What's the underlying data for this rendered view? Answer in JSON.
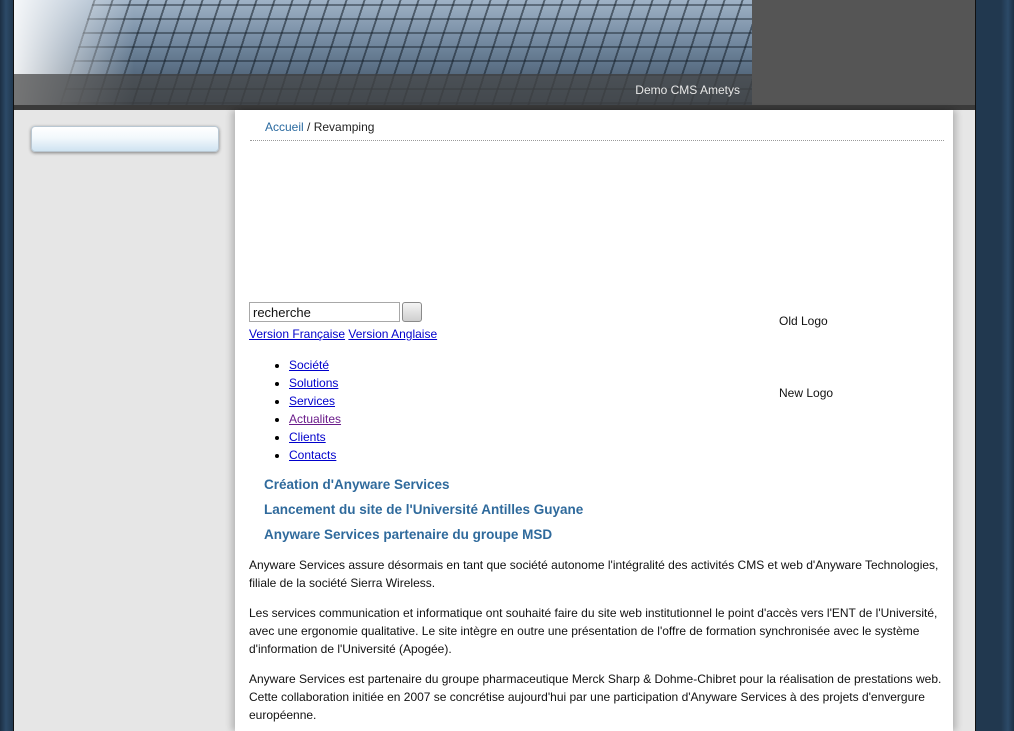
{
  "header": {
    "banner_caption": "Demo CMS Ametys"
  },
  "breadcrumb": {
    "home": "Accueil",
    "separator": "/",
    "current": "Revamping"
  },
  "search": {
    "value": "recherche"
  },
  "languages": {
    "french": "Version Française",
    "english": "Version Anglaise"
  },
  "logos": {
    "old": "Old Logo",
    "new": "New Logo"
  },
  "menu": {
    "items": [
      {
        "label": "Société"
      },
      {
        "label": "Solutions"
      },
      {
        "label": "Services"
      },
      {
        "label": "Actualites"
      },
      {
        "label": "Clients"
      },
      {
        "label": "Contacts"
      }
    ]
  },
  "news": {
    "titles": [
      "Création d'Anyware Services",
      "Lancement du site de l'Université Antilles Guyane",
      "Anyware Services partenaire du groupe MSD"
    ],
    "paragraphs": [
      "Anyware Services assure désormais en tant que société autonome l'intégralité des activités CMS et web d'Anyware Technologies, filiale de la société Sierra Wireless.",
      "Les services communication et informatique ont souhaité faire du site web institutionnel le point d'accès vers l'ENT de l'Université, avec une ergonomie qualitative. Le site intègre en outre une présentation de l'offre de formation synchronisée avec le système d'information de l'Université (Apogée).",
      "Anyware Services est partenaire du groupe pharmaceutique Merck Sharp & Dohme-Chibret pour la réalisation de prestations web. Cette collaboration initiée en 2007 se concrétise aujourd'hui par une participation d'Anyware Services à des projets d'envergure européenne."
    ]
  },
  "colors": {
    "link": "#0000cc",
    "visited_link": "#6a1b8a",
    "news_title": "#2f6a9c",
    "breadcrumb_link": "#2a6aa0"
  }
}
